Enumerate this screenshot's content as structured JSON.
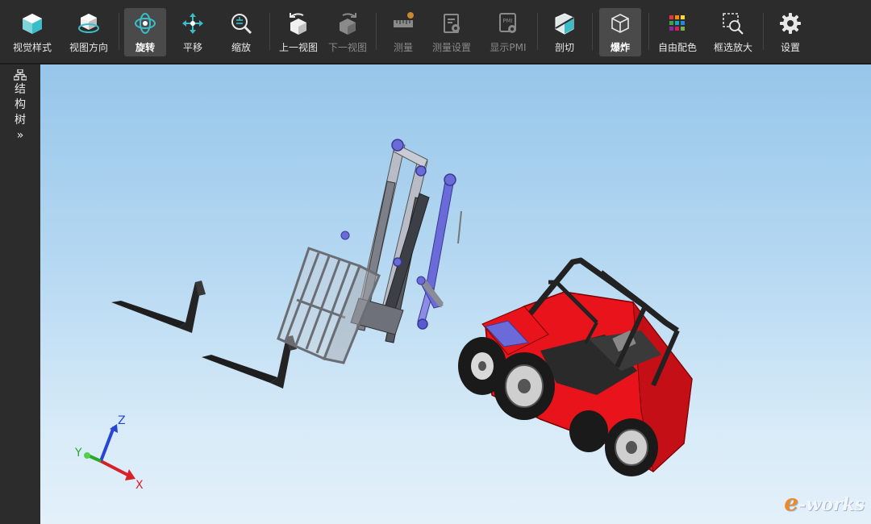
{
  "toolbar": {
    "buttons": [
      {
        "label": "视觉样式",
        "icon": "cube-style-icon",
        "state": "normal"
      },
      {
        "label": "视图方向",
        "icon": "view-direction-icon",
        "state": "normal"
      },
      {
        "label": "旋转",
        "icon": "rotate-icon",
        "state": "active"
      },
      {
        "label": "平移",
        "icon": "pan-icon",
        "state": "normal"
      },
      {
        "label": "缩放",
        "icon": "zoom-icon",
        "state": "normal"
      },
      {
        "label": "上一视图",
        "icon": "previous-view-icon",
        "state": "normal"
      },
      {
        "label": "下一视图",
        "icon": "next-view-icon",
        "state": "disabled"
      },
      {
        "label": "测量",
        "icon": "ruler-icon",
        "state": "disabled"
      },
      {
        "label": "测量设置",
        "icon": "measure-settings-icon",
        "state": "disabled"
      },
      {
        "label": "显示PMI",
        "icon": "pmi-icon",
        "state": "disabled"
      },
      {
        "label": "剖切",
        "icon": "section-cut-icon",
        "state": "normal"
      },
      {
        "label": "爆炸",
        "icon": "explode-icon",
        "state": "active"
      },
      {
        "label": "自由配色",
        "icon": "color-palette-icon",
        "state": "normal"
      },
      {
        "label": "框选放大",
        "icon": "box-zoom-icon",
        "state": "normal"
      },
      {
        "label": "设置",
        "icon": "gear-icon",
        "state": "normal"
      }
    ]
  },
  "sidebar": {
    "tree_label_chars": [
      "结",
      "构",
      "树"
    ],
    "expand_glyph": "»"
  },
  "viewport": {
    "axes": {
      "x": "X",
      "y": "Y",
      "z": "Z"
    },
    "watermark": {
      "e": "e",
      "rest": "-works"
    }
  },
  "colors": {
    "toolbar_bg": "#2c2c2c",
    "accent_teal": "#3bbdc9",
    "forklift_red": "#e8131b",
    "hydraulic_blue": "#6a6ad8"
  }
}
